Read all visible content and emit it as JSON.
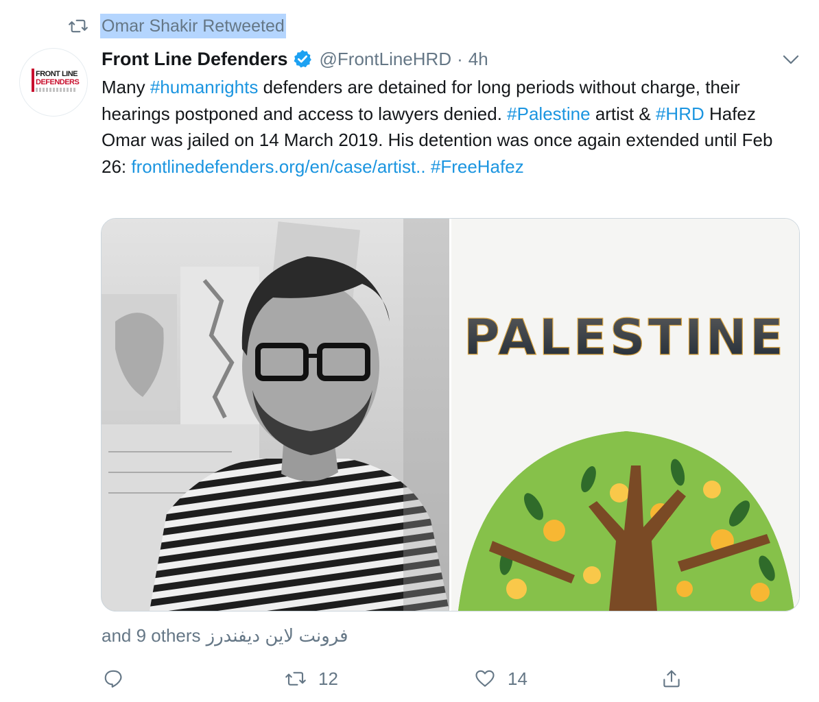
{
  "retweet_banner": {
    "text": "Omar Shakir Retweeted",
    "icon": "retweet-icon"
  },
  "avatar": {
    "logo_line1": "FRONT LINE",
    "logo_line2": "DEFENDERS",
    "brand_color": "#c8102e"
  },
  "header": {
    "display_name": "Front Line Defenders",
    "verified_icon": "verified-badge-icon",
    "handle": "@FrontLineHRD",
    "separator": "·",
    "time": "4h",
    "caret_icon": "chevron-down-icon"
  },
  "tweet": {
    "segments": [
      {
        "type": "text",
        "value": "Many "
      },
      {
        "type": "hashtag",
        "value": "#humanrights"
      },
      {
        "type": "text",
        "value": " defenders are detained for long periods without charge, their hearings postponed and access to lawyers denied. "
      },
      {
        "type": "hashtag",
        "value": "#Palestine"
      },
      {
        "type": "text",
        "value": " artist & "
      },
      {
        "type": "hashtag",
        "value": "#HRD"
      },
      {
        "type": "text",
        "value": " Hafez Omar was jailed on 14 March 2019. His detention was once again extended until Feb 26: "
      },
      {
        "type": "link",
        "value": "frontlinedefenders.org/en/case/artist.."
      },
      {
        "type": "text",
        "value": " "
      },
      {
        "type": "hashtag",
        "value": "#FreeHafez"
      }
    ]
  },
  "media": {
    "left_image": "portrait-photo",
    "right_image_title": "PALESTINE"
  },
  "footer": {
    "liked_by_latin": "and 9 others",
    "liked_by_arabic": "فرونت لاين ديفندرز"
  },
  "actions": {
    "reply_icon": "reply-icon",
    "retweet_icon": "retweet-icon",
    "retweet_count": "12",
    "like_icon": "heart-icon",
    "like_count": "14",
    "share_icon": "share-icon"
  },
  "colors": {
    "link": "#1b95e0",
    "text": "#14171a",
    "muted": "#657786",
    "verified": "#1da1f2",
    "highlight": "#b4d5fe"
  }
}
